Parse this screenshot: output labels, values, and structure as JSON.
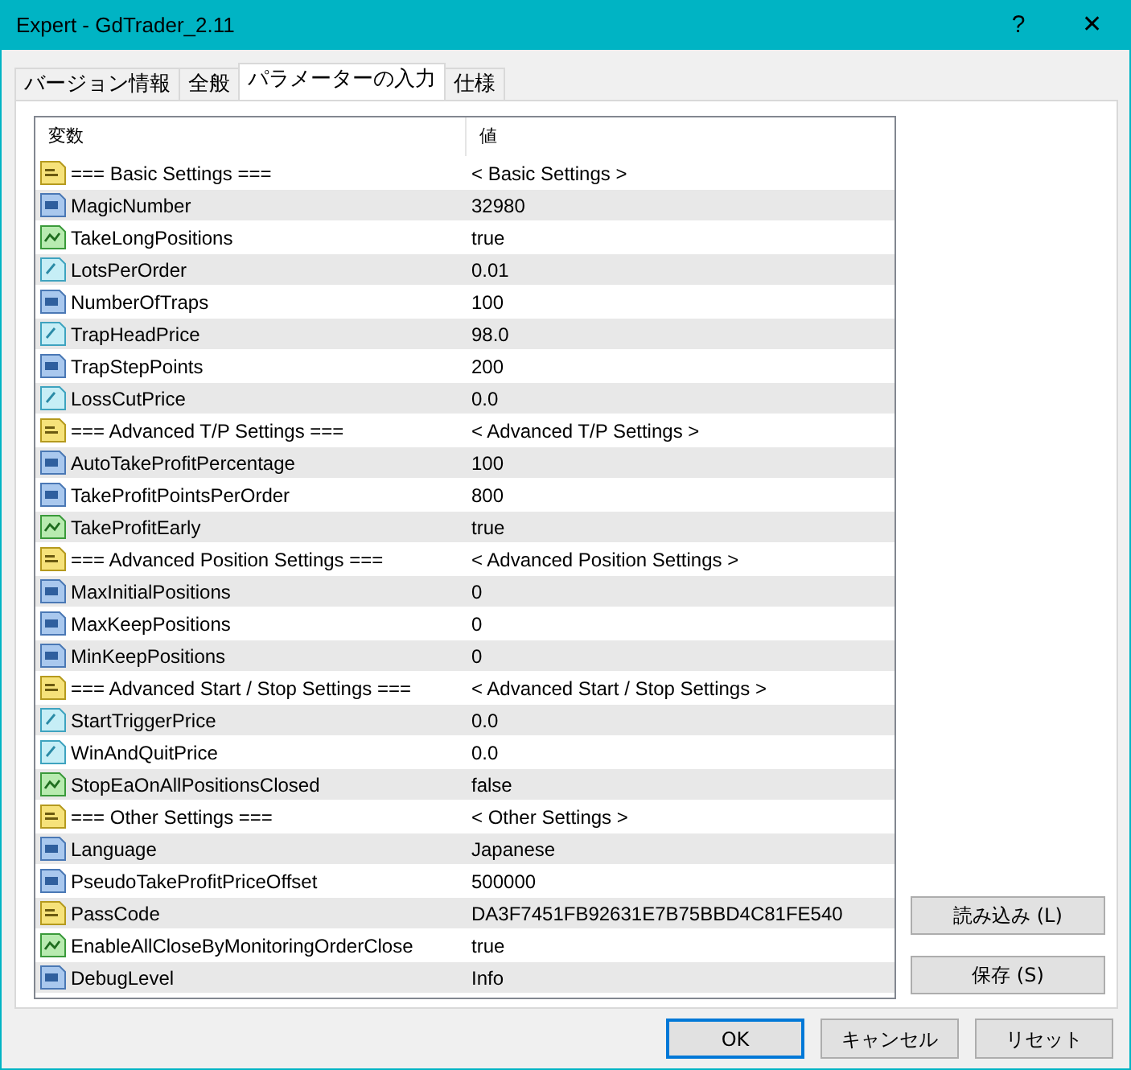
{
  "window": {
    "title": "Expert - GdTrader_2.11",
    "help": "?",
    "close": "✕"
  },
  "tabs": [
    {
      "label": "バージョン情報",
      "selected": false
    },
    {
      "label": "全般",
      "selected": false
    },
    {
      "label": "パラメーターの入力",
      "selected": true
    },
    {
      "label": "仕様",
      "selected": false
    }
  ],
  "table": {
    "columns": [
      "変数",
      "値"
    ],
    "rows": [
      {
        "kind": "string",
        "name": "=== Basic Settings ===",
        "value": "< Basic Settings >"
      },
      {
        "kind": "int",
        "name": "MagicNumber",
        "value": "32980"
      },
      {
        "kind": "bool",
        "name": "TakeLongPositions",
        "value": "true"
      },
      {
        "kind": "double",
        "name": "LotsPerOrder",
        "value": "0.01"
      },
      {
        "kind": "int",
        "name": "NumberOfTraps",
        "value": "100"
      },
      {
        "kind": "double",
        "name": "TrapHeadPrice",
        "value": "98.0"
      },
      {
        "kind": "int",
        "name": "TrapStepPoints",
        "value": "200"
      },
      {
        "kind": "double",
        "name": "LossCutPrice",
        "value": "0.0"
      },
      {
        "kind": "string",
        "name": "=== Advanced T/P Settings ===",
        "value": "< Advanced T/P Settings >"
      },
      {
        "kind": "int",
        "name": "AutoTakeProfitPercentage",
        "value": "100"
      },
      {
        "kind": "int",
        "name": "TakeProfitPointsPerOrder",
        "value": "800"
      },
      {
        "kind": "bool",
        "name": "TakeProfitEarly",
        "value": "true"
      },
      {
        "kind": "string",
        "name": "=== Advanced Position Settings ===",
        "value": "< Advanced Position Settings >"
      },
      {
        "kind": "int",
        "name": "MaxInitialPositions",
        "value": "0"
      },
      {
        "kind": "int",
        "name": "MaxKeepPositions",
        "value": "0"
      },
      {
        "kind": "int",
        "name": "MinKeepPositions",
        "value": "0"
      },
      {
        "kind": "string",
        "name": "=== Advanced Start / Stop Settings ===",
        "value": "< Advanced Start / Stop Settings >"
      },
      {
        "kind": "double",
        "name": "StartTriggerPrice",
        "value": "0.0"
      },
      {
        "kind": "double",
        "name": "WinAndQuitPrice",
        "value": "0.0"
      },
      {
        "kind": "bool",
        "name": "StopEaOnAllPositionsClosed",
        "value": "false"
      },
      {
        "kind": "string",
        "name": "=== Other Settings ===",
        "value": "< Other Settings >"
      },
      {
        "kind": "int",
        "name": "Language",
        "value": "Japanese"
      },
      {
        "kind": "int",
        "name": "PseudoTakeProfitPriceOffset",
        "value": "500000"
      },
      {
        "kind": "string",
        "name": "PassCode",
        "value": "DA3F7451FB92631E7B75BBD4C81FE540"
      },
      {
        "kind": "bool",
        "name": "EnableAllCloseByMonitoringOrderClose",
        "value": "true"
      },
      {
        "kind": "int",
        "name": "DebugLevel",
        "value": "Info"
      }
    ]
  },
  "side_buttons": [
    "読み込み (L)",
    "保存 (S)"
  ],
  "buttons": [
    {
      "label": "OK",
      "default": true
    },
    {
      "label": "キャンセル",
      "default": false
    },
    {
      "label": "リセット",
      "default": false
    }
  ]
}
